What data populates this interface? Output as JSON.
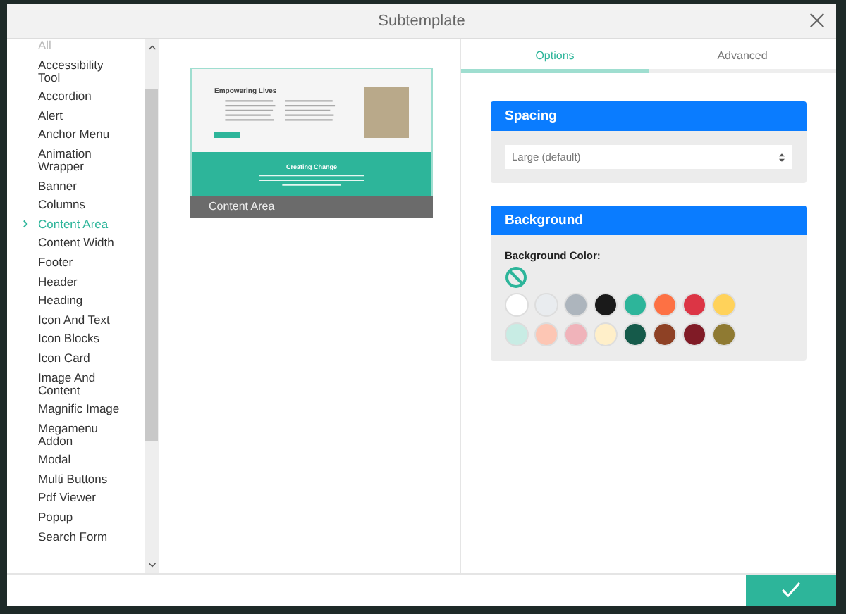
{
  "window": {
    "title": "Subtemplate"
  },
  "sidebar": {
    "items": [
      {
        "label": "All",
        "selected": false
      },
      {
        "label": "Accessibility Tool",
        "selected": false
      },
      {
        "label": "Accordion",
        "selected": false
      },
      {
        "label": "Alert",
        "selected": false
      },
      {
        "label": "Anchor Menu",
        "selected": false
      },
      {
        "label": "Animation Wrapper",
        "selected": false
      },
      {
        "label": "Banner",
        "selected": false
      },
      {
        "label": "Columns",
        "selected": false
      },
      {
        "label": "Content Area",
        "selected": true
      },
      {
        "label": "Content Width",
        "selected": false
      },
      {
        "label": "Footer",
        "selected": false
      },
      {
        "label": "Header",
        "selected": false
      },
      {
        "label": "Heading",
        "selected": false
      },
      {
        "label": "Icon And Text",
        "selected": false
      },
      {
        "label": "Icon Blocks",
        "selected": false
      },
      {
        "label": "Icon Card",
        "selected": false
      },
      {
        "label": "Image And Content",
        "selected": false
      },
      {
        "label": "Magnific Image",
        "selected": false
      },
      {
        "label": "Megamenu Addon",
        "selected": false
      },
      {
        "label": "Modal",
        "selected": false
      },
      {
        "label": "Multi Buttons",
        "selected": false
      },
      {
        "label": "Pdf Viewer",
        "selected": false
      },
      {
        "label": "Popup",
        "selected": false
      },
      {
        "label": "Search Form",
        "selected": false
      }
    ]
  },
  "preview": {
    "heading": "Empowering Lives",
    "band_heading": "Creating Change",
    "caption": "Content Area"
  },
  "tabs": [
    {
      "label": "Options",
      "selected": true
    },
    {
      "label": "Advanced",
      "selected": false
    }
  ],
  "spacing": {
    "title": "Spacing",
    "value": "Large (default)"
  },
  "background": {
    "title": "Background",
    "label": "Background Color:",
    "swatches": [
      {
        "color": "#ffffff"
      },
      {
        "color": "#e9ecef"
      },
      {
        "color": "#adb5bd"
      },
      {
        "color": "#1a1a1a"
      },
      {
        "color": "#2db59a"
      },
      {
        "color": "#fd7144"
      },
      {
        "color": "#dc3545"
      },
      {
        "color": "#ffd25a"
      },
      {
        "color": "#c8ece4"
      },
      {
        "color": "#fdc6b4"
      },
      {
        "color": "#f0b3ba"
      },
      {
        "color": "#ffefc9"
      },
      {
        "color": "#155a4a"
      },
      {
        "color": "#8e4125"
      },
      {
        "color": "#801b26"
      },
      {
        "color": "#8f7a32"
      }
    ]
  }
}
